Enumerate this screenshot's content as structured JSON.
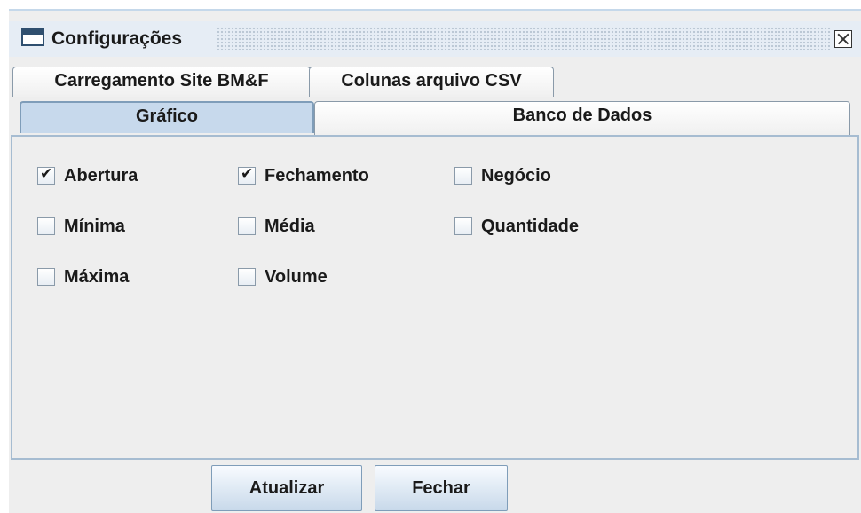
{
  "window": {
    "title": "Configurações"
  },
  "tabs_row1": [
    "Carregamento Site BM&F",
    "Colunas arquivo CSV"
  ],
  "tabs_row2": [
    "Gráfico",
    "Banco de Dados"
  ],
  "checkboxes": [
    {
      "label": "Abertura",
      "checked": true
    },
    {
      "label": "Fechamento",
      "checked": true
    },
    {
      "label": "Negócio",
      "checked": false
    },
    {
      "label": "Mínima",
      "checked": false
    },
    {
      "label": "Média",
      "checked": false
    },
    {
      "label": "Quantidade",
      "checked": false
    },
    {
      "label": "Máxima",
      "checked": false
    },
    {
      "label": "Volume",
      "checked": false
    }
  ],
  "buttons": {
    "update": "Atualizar",
    "close": "Fechar"
  }
}
